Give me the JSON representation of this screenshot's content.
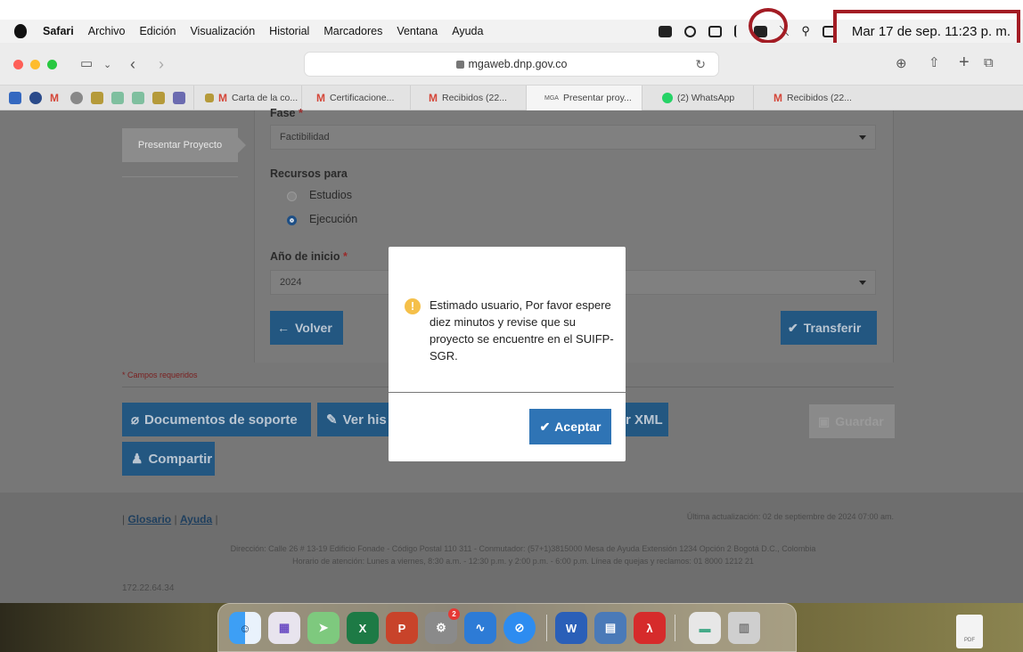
{
  "menubar": {
    "items": [
      "Safari",
      "Archivo",
      "Edición",
      "Visualización",
      "Historial",
      "Marcadores",
      "Ventana",
      "Ayuda"
    ],
    "clock": "Mar 17 de sep.  11:23 p. m."
  },
  "browser": {
    "url": "mgaweb.dnp.gov.co",
    "tabs": [
      {
        "label": "Carta de la co..."
      },
      {
        "label": "Certificacione..."
      },
      {
        "label": "Recibidos (22..."
      },
      {
        "label": "Presentar proy..."
      },
      {
        "label": "(2) WhatsApp"
      },
      {
        "label": "Recibidos (22..."
      }
    ]
  },
  "page": {
    "sidebar_button": "Presentar Proyecto",
    "fase_label": "Fase",
    "fase_value": "Factibilidad",
    "recursos_label": "Recursos para",
    "recursos_options": [
      "Estudios",
      "Ejecución"
    ],
    "anio_label": "Año de inicio",
    "anio_value": "2024",
    "required_mark": "*",
    "volver_button": "Volver",
    "transferir_button": "Transferir",
    "campos_requeridos": "* Campos requeridos",
    "documentos_button": "Documentos de soporte",
    "ver_button": "Ver his",
    "xml_button": "r XML",
    "guardar_button": "Guardar",
    "compartir_button": "Compartir"
  },
  "footer": {
    "glosario": "Glosario",
    "ayuda": "Ayuda",
    "updated": "Última actualización: 02 de septiembre de 2024 07:00 am.",
    "address_line1": "Dirección: Calle 26 # 13-19 Edificio Fonade - Código Postal 110 311 - Conmutador: (57+1)3815000 Mesa de Ayuda Extensión 1234 Opción 2 Bogotá D.C., Colombia",
    "address_line2": "Horario de atención: Lunes a viernes, 8:30 a.m. - 12:30 p.m. y 2:00 p.m. - 6:00 p.m. Línea de quejas y reclamos: 01 8000 1212 21",
    "ip": "172.22.64.34"
  },
  "dialog": {
    "message": "Estimado usuario, Por favor espere diez minutos y revise que su proyecto se encuentre en el SUIFP-SGR.",
    "accept_button": "Aceptar"
  },
  "dock": {
    "pdf_label": "PDF",
    "settings_badge": "2"
  },
  "colors": {
    "accent_blue": "#2f74b5",
    "dimmed_blue": "#235781",
    "annotation_red": "#a31c24"
  }
}
